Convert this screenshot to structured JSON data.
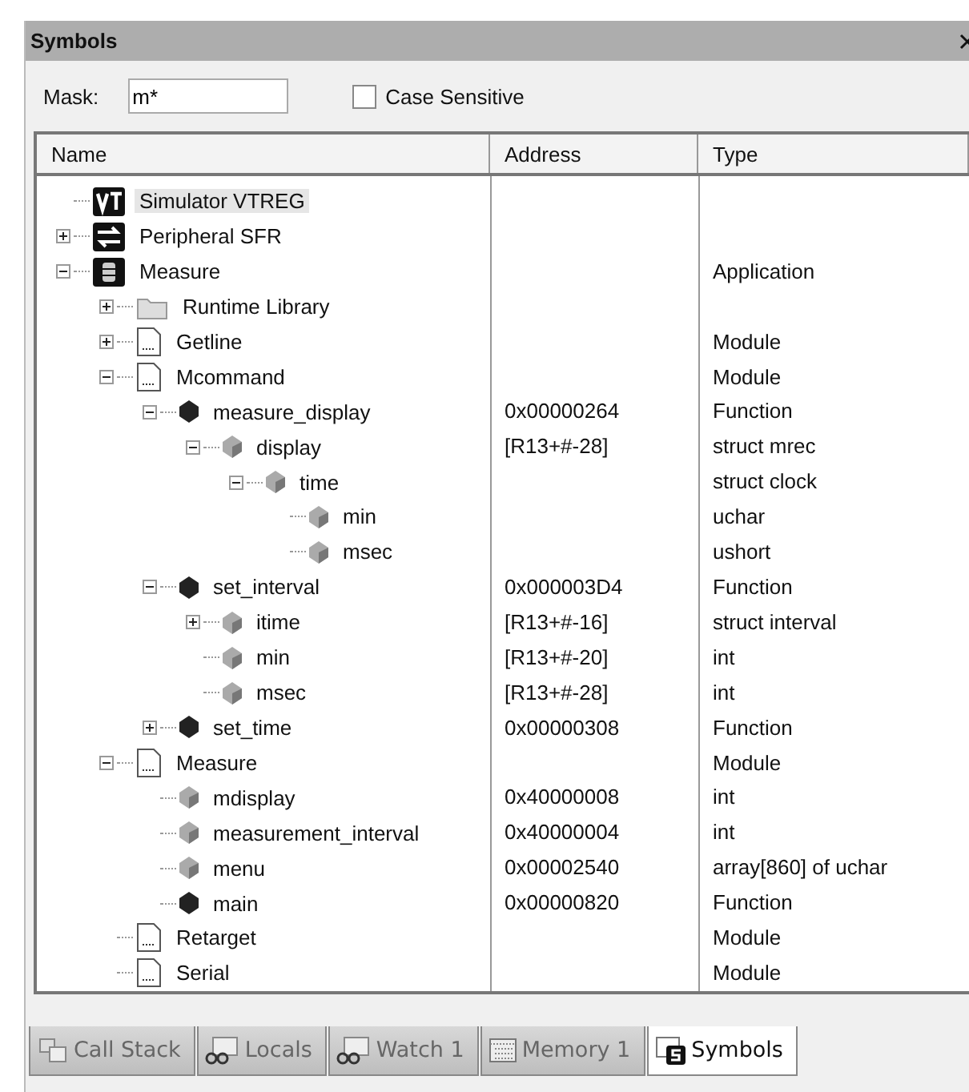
{
  "window": {
    "title": "Symbols"
  },
  "mask": {
    "label": "Mask:",
    "value": "m*"
  },
  "case_sensitive": {
    "label": "Case Sensitive",
    "checked": false
  },
  "columns": [
    "Name",
    "Address",
    "Type"
  ],
  "tree": [
    {
      "kind": "vt",
      "name": "Simulator VTREG",
      "selected": true
    },
    {
      "kind": "peripheral",
      "name": "Peripheral SFR",
      "expanded": false,
      "selected": false
    },
    {
      "kind": "app",
      "name": "Measure",
      "type": "Application",
      "expanded": true,
      "selected": false,
      "children": [
        {
          "kind": "folder",
          "name": "Runtime Library",
          "expanded": false,
          "selected": false
        },
        {
          "kind": "module",
          "name": "Getline",
          "type": "Module",
          "expanded": false,
          "selected": false
        },
        {
          "kind": "module",
          "name": "Mcommand",
          "type": "Module",
          "expanded": true,
          "selected": false,
          "children": [
            {
              "kind": "function",
              "name": "measure_display",
              "address": "0x00000264",
              "type": "Function",
              "expanded": true,
              "selected": false,
              "children": [
                {
                  "kind": "variable",
                  "name": "display",
                  "address": "[R13+#-28]",
                  "type": "struct mrec",
                  "expanded": true,
                  "selected": false,
                  "children": [
                    {
                      "kind": "variable",
                      "name": "time",
                      "type": "struct clock",
                      "expanded": true,
                      "selected": false,
                      "children": [
                        {
                          "kind": "variable",
                          "name": "min",
                          "type": "uchar",
                          "selected": false
                        },
                        {
                          "kind": "variable",
                          "name": "msec",
                          "type": "ushort",
                          "selected": false
                        }
                      ]
                    }
                  ]
                }
              ]
            },
            {
              "kind": "function",
              "name": "set_interval",
              "address": "0x000003D4",
              "type": "Function",
              "expanded": true,
              "selected": false,
              "children": [
                {
                  "kind": "variable",
                  "name": "itime",
                  "address": "[R13+#-16]",
                  "type": "struct interval",
                  "expanded": false,
                  "selected": false
                },
                {
                  "kind": "variable",
                  "name": "min",
                  "address": "[R13+#-20]",
                  "type": "int",
                  "selected": false
                },
                {
                  "kind": "variable",
                  "name": "msec",
                  "address": "[R13+#-28]",
                  "type": "int",
                  "selected": false
                }
              ]
            },
            {
              "kind": "function",
              "name": "set_time",
              "address": "0x00000308",
              "type": "Function",
              "expanded": false,
              "selected": false
            }
          ]
        },
        {
          "kind": "module",
          "name": "Measure",
          "type": "Module",
          "expanded": true,
          "selected": false,
          "children": [
            {
              "kind": "variable",
              "name": "mdisplay",
              "address": "0x40000008",
              "type": "int",
              "selected": false
            },
            {
              "kind": "variable",
              "name": "measurement_interval",
              "address": "0x40000004",
              "type": "int",
              "selected": false
            },
            {
              "kind": "variable",
              "name": "menu",
              "address": "0x00002540",
              "type": "array[860] of uchar",
              "selected": false
            },
            {
              "kind": "function",
              "name": "main",
              "address": "0x00000820",
              "type": "Function",
              "selected": false
            }
          ]
        },
        {
          "kind": "module",
          "name": "Retarget",
          "type": "Module",
          "selected": false
        },
        {
          "kind": "module",
          "name": "Serial",
          "type": "Module",
          "selected": false
        }
      ]
    }
  ],
  "tabs": [
    {
      "kind": "callstack",
      "label": "Call Stack",
      "selected": false
    },
    {
      "kind": "locals",
      "label": "Locals",
      "selected": false
    },
    {
      "kind": "watch",
      "label": "Watch 1",
      "selected": false
    },
    {
      "kind": "memory",
      "label": "Memory 1",
      "selected": false
    },
    {
      "kind": "symbols",
      "label": "Symbols",
      "selected": true
    }
  ]
}
